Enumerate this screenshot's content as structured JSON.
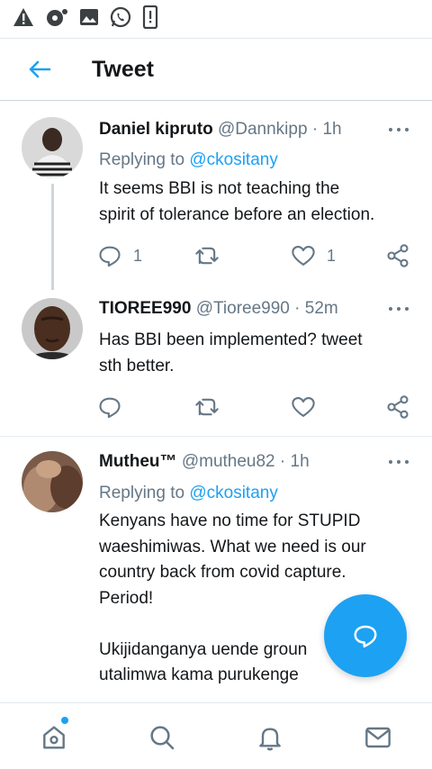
{
  "status_bar": {
    "icons": [
      "warning-icon",
      "dnd-mode-icon",
      "gallery-icon",
      "whatsapp-icon",
      "phone-alert-icon"
    ]
  },
  "header": {
    "back_icon": "arrow-left-icon",
    "title": "Tweet"
  },
  "colors": {
    "accent": "#1da1f2",
    "text_primary": "#14171a",
    "text_secondary": "#657786",
    "divider": "#e6ecf0"
  },
  "tweets": [
    {
      "name": "Daniel kipruto",
      "handle": "@Dannkipp",
      "separator": "·",
      "time": "1h",
      "replying_prefix": "Replying to",
      "replying_to": "@ckositany",
      "text": [
        "It seems BBI is not teaching the",
        "spirit of tolerance before an election."
      ],
      "reply_count": "1",
      "like_count": "1"
    },
    {
      "name": "TIOREE990",
      "handle": "@Tioree990",
      "separator": "·",
      "time": "52m",
      "text": [
        "Has BBI been implemented? tweet",
        "sth better."
      ]
    },
    {
      "name": "Mutheu™",
      "handle": "@mutheu82",
      "separator": "·",
      "time": "1h",
      "replying_prefix": "Replying to",
      "replying_to": "@ckositany",
      "text": [
        "Kenyans have no time for STUPID",
        "waeshimiwas. What we need is our",
        "country back from covid capture.",
        "Period!",
        "",
        "Ukijidanganya uende groun",
        "utalimwa kama purukenge"
      ]
    }
  ],
  "fab": {
    "icon": "reply-bubble-icon"
  },
  "bottom_nav": {
    "items": [
      "home-icon",
      "search-icon",
      "notifications-icon",
      "messages-icon"
    ],
    "home_has_notification_dot": true
  }
}
